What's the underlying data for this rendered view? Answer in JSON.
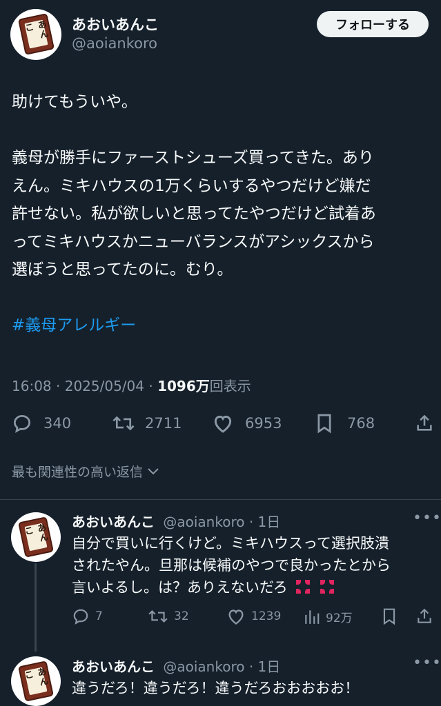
{
  "tweet": {
    "author": {
      "name": "あおいあんこ",
      "handle": "@aoiankoro",
      "avatar_label": "あんこ"
    },
    "follow_label": "フォローする",
    "body_lines": [
      "助けてもういや。",
      "",
      "義母が勝手にファーストシューズ買ってきた。あり",
      "えん。ミキハウスの1万くらいするやつだけど嫌だ",
      "許せない。私が欲しいと思ってたやつだけど試着あ",
      "ってミキハウスかニューバランスがアシックスから",
      "選ぼうと思ってたのに。むり。",
      ""
    ],
    "hashtag": "#義母アレルギー",
    "time": "16:08",
    "date": "2025/05/04",
    "views_count": "1096万",
    "views_label": "回表示",
    "stats": {
      "replies": "340",
      "retweets": "2711",
      "likes": "6953",
      "bookmarks": "768"
    }
  },
  "sort_label": "最も関連性の高い返信",
  "replies": [
    {
      "name": "あおいあんこ",
      "handle_time": "@aoiankoro · 1日",
      "lines": [
        "自分で買いに行くけど。ミキハウスって選択肢潰",
        "されたやん。旦那は候補のやつで良かったとから",
        "言いよるし。は？ありえないだろ"
      ],
      "stats": {
        "replies": "7",
        "retweets": "32",
        "likes": "1239",
        "views": "92万"
      }
    },
    {
      "name": "あおいあんこ",
      "handle_time": "@aoiankoro · 1日",
      "lines": [
        "違うだろ！違うだろ！違うだろおおおおお！"
      ]
    }
  ],
  "colors": {
    "background": "#15202b",
    "text": "#f7f9f9",
    "secondary": "#8b98a5",
    "link": "#1d9bf0",
    "anger": "#e0245e"
  }
}
